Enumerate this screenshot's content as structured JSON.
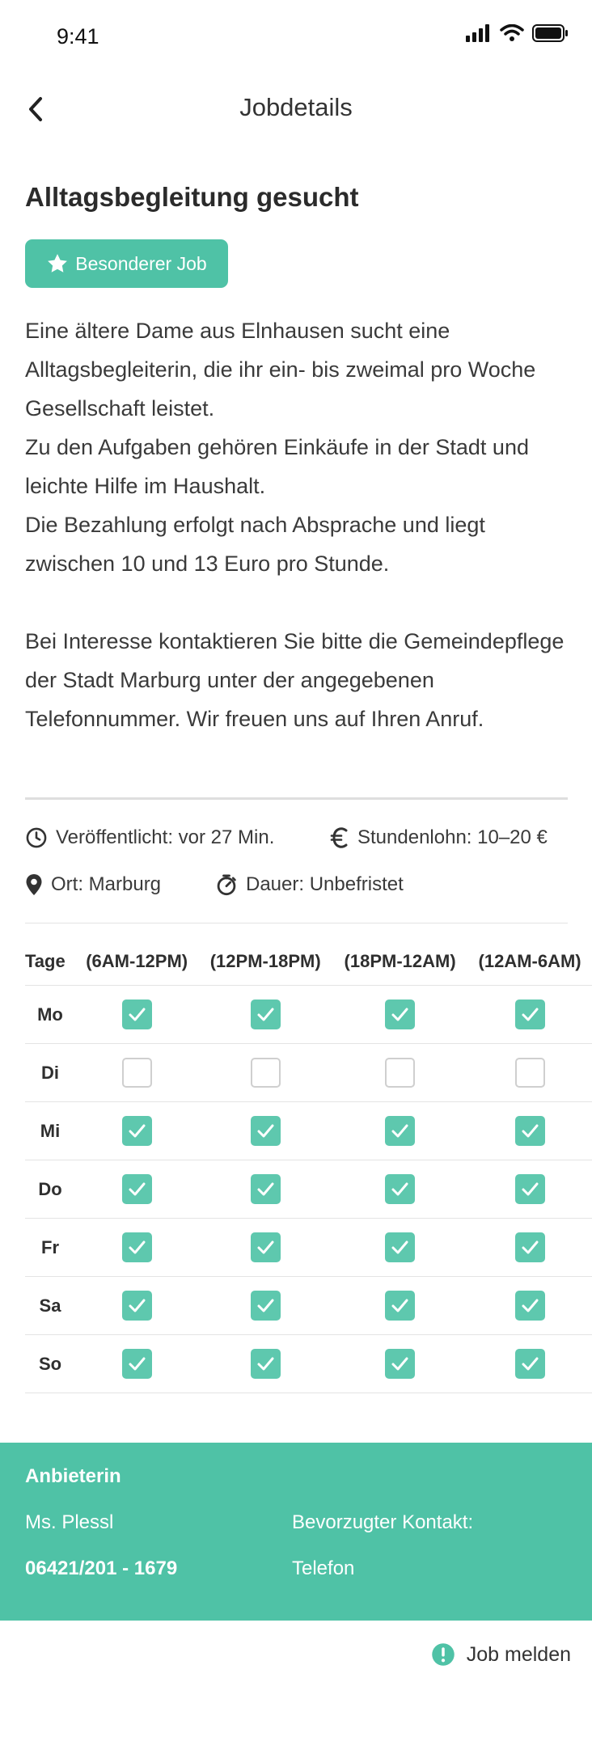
{
  "status_bar": {
    "time": "9:41"
  },
  "nav": {
    "title": "Jobdetails",
    "back_icon": "chevron-left-icon"
  },
  "job": {
    "title": "Alltagsbegleitung gesucht",
    "badge_label": "Besonderer Job",
    "description": [
      "Eine ältere Dame aus Elnhausen sucht eine Alltagsbegleiterin, die ihr ein- bis zweimal pro Woche Gesellschaft leistet.",
      "Zu den Aufgaben gehören Einkäufe in der Stadt und leichte Hilfe im Haushalt.",
      "Die Bezahlung erfolgt nach Absprache und liegt zwischen 10 und 13 Euro pro Stunde.",
      "Bei Interesse kontaktieren Sie bitte die Gemeindepflege der Stadt Marburg unter der angegebenen Telefonnummer. Wir freuen uns auf Ihren Anruf."
    ]
  },
  "meta": {
    "published": "Veröffentlicht: vor 27 Min.",
    "wage": "Stundenlohn: 10–20 €",
    "location": "Ort: Marburg",
    "duration": "Dauer: Unbefristet"
  },
  "schedule": {
    "headers": [
      "Tage",
      "(6AM-12PM)",
      "(12PM-18PM)",
      "(18PM-12AM)",
      "(12AM-6AM)"
    ],
    "rows": [
      {
        "day": "Mo",
        "slots": [
          true,
          true,
          true,
          true
        ]
      },
      {
        "day": "Di",
        "slots": [
          false,
          false,
          false,
          false
        ]
      },
      {
        "day": "Mi",
        "slots": [
          true,
          true,
          true,
          true
        ]
      },
      {
        "day": "Do",
        "slots": [
          true,
          true,
          true,
          true
        ]
      },
      {
        "day": "Fr",
        "slots": [
          true,
          true,
          true,
          true
        ]
      },
      {
        "day": "Sa",
        "slots": [
          true,
          true,
          true,
          true
        ]
      },
      {
        "day": "So",
        "slots": [
          true,
          true,
          true,
          true
        ]
      }
    ]
  },
  "provider": {
    "heading": "Anbieterin",
    "name": "Ms. Plessl",
    "phone": "06421/201 - 1679",
    "preferred_contact_label": "Bevorzugter Kontakt:",
    "preferred_contact_value": "Telefon"
  },
  "report": {
    "label": "Job melden"
  },
  "colors": {
    "accent": "#4fc2a6",
    "checkbox_checked": "#5ec8ae",
    "text": "#333333"
  }
}
